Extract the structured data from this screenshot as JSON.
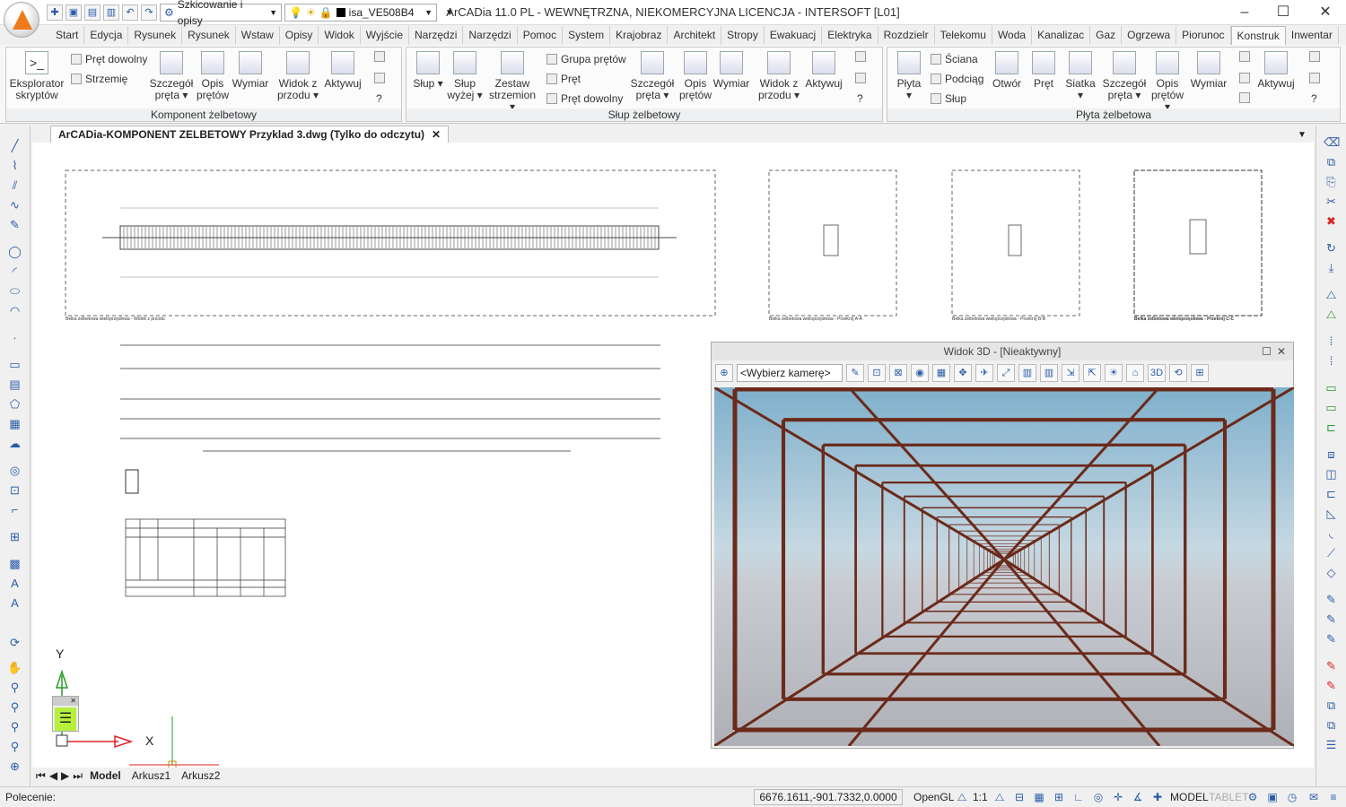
{
  "title_bar": {
    "title": "ArCADia 11.0 PL - WEWNĘTRZNA, NIEKOMERCYJNA LICENCJA - INTERSOFT [L01]",
    "workspace": "Szkicowanie i opisy",
    "layer": "isa_VE508B4"
  },
  "ribbon_tabs": [
    "Start",
    "Edycja",
    "Rysunek",
    "Rysunek",
    "Wstaw",
    "Opisy",
    "Widok",
    "Wyjście",
    "Narzędzi",
    "Narzędzi",
    "Pomoc",
    "System",
    "Krajobraz",
    "Architekt",
    "Stropy",
    "Ewakuacj",
    "Elektryka",
    "Rozdzielr",
    "Telekomu",
    "Woda",
    "Kanalizac",
    "Gaz",
    "Ogrzewa",
    "Piorunoc",
    "Konstruk",
    "Inwentar"
  ],
  "active_tab": "Konstruk",
  "panels": {
    "p1": {
      "title": "Komponent żelbetowy",
      "explorer": "Eksplorator skryptów",
      "small": [
        "Pręt dowolny",
        "Strzemię"
      ],
      "btns": [
        "Szczegół pręta ▾",
        "Opis prętów",
        "Wymiar",
        "Widok z przodu ▾",
        "Aktywuj"
      ]
    },
    "p2": {
      "title": "Słup żelbetowy",
      "btns_left": [
        "Słup ▾",
        "Słup wyżej ▾",
        "Zestaw strzemion ▾"
      ],
      "small": [
        "Grupa prętów",
        "Pręt",
        "Pręt dowolny"
      ],
      "btns": [
        "Szczegół pręta ▾",
        "Opis prętów",
        "Wymiar",
        "Widok z przodu ▾",
        "Aktywuj"
      ]
    },
    "p3": {
      "title": "Płyta żelbetowa",
      "btns_left": [
        "Płyta ▾"
      ],
      "small": [
        "Ściana",
        "Podciąg",
        "Słup"
      ],
      "btns": [
        "Otwór",
        "Pręt",
        "Siatka ▾",
        "Szczegół pręta ▾",
        "Opis prętów ▾",
        "Wymiar",
        "Aktywuj"
      ]
    }
  },
  "document_tab": "ArCADia-KOMPONENT ZELBETOWY Przyklad 3.dwg (Tylko do odczytu)",
  "drawing_captions": {
    "front": "Belka żelbetowa wieloprzęsłowa - Widok z przodu",
    "sec_aa": "Belka żelbetowa wieloprzęsłowa - Przekrój A-A",
    "sec_bb": "Belka żelbetowa wieloprzęsłowa - Przekrój B-B",
    "sec_cc": "Belka żelbetowa wieloprzęsłowa - Przekrój C-C"
  },
  "view3d": {
    "title": "Widok 3D - [Nieaktywny]",
    "camera": "<Wybierz kamerę>"
  },
  "ucs": {
    "y": "Y",
    "x": "X"
  },
  "layout_tabs": [
    "Model",
    "Arkusz1",
    "Arkusz2"
  ],
  "status": {
    "command": "Polecenie:",
    "coords": "6676.1611,-901.7332,0.0000",
    "renderer": "OpenGL",
    "scale": "1:1",
    "model": "MODEL",
    "tablet": "TABLET"
  }
}
